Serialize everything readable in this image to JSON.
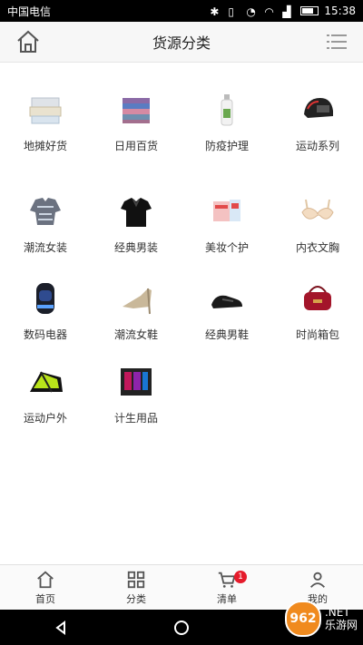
{
  "status": {
    "carrier": "中国电信",
    "time": "15:38",
    "icons": [
      "bluetooth-icon",
      "vibrate-icon",
      "alarm-icon",
      "wifi-icon",
      "signal-icon",
      "battery-icon"
    ]
  },
  "header": {
    "title": "货源分类",
    "left_icon": "home-icon",
    "right_icon": "list-menu-icon"
  },
  "categories": [
    {
      "label": "地摊好货",
      "icon": "storage-boxes-icon"
    },
    {
      "label": "日用百货",
      "icon": "towels-icon"
    },
    {
      "label": "防疫护理",
      "icon": "spray-bottle-icon"
    },
    {
      "label": "运动系列",
      "icon": "helmet-icon"
    },
    {
      "label": "潮流女装",
      "icon": "blouse-icon"
    },
    {
      "label": "经典男装",
      "icon": "polo-shirt-icon"
    },
    {
      "label": "美妆个护",
      "icon": "cosmetics-icon"
    },
    {
      "label": "内衣文胸",
      "icon": "bra-icon"
    },
    {
      "label": "数码电器",
      "icon": "mosquito-lamp-icon"
    },
    {
      "label": "潮流女鞋",
      "icon": "heel-shoe-icon"
    },
    {
      "label": "经典男鞋",
      "icon": "men-shoe-icon"
    },
    {
      "label": "时尚箱包",
      "icon": "handbag-icon"
    },
    {
      "label": "运动户外",
      "icon": "tent-icon"
    },
    {
      "label": "计生用品",
      "icon": "adult-products-icon"
    }
  ],
  "tabs": [
    {
      "label": "首页",
      "icon": "home-icon"
    },
    {
      "label": "分类",
      "icon": "grid-icon"
    },
    {
      "label": "清单",
      "icon": "cart-icon",
      "badge": "1"
    },
    {
      "label": "我的",
      "icon": "user-icon"
    }
  ],
  "watermark": {
    "badge": "962",
    "text": ".NET",
    "subtext": "乐游网"
  },
  "colors": {
    "badge": "#e51b2b",
    "watermark": "#f08a1e"
  }
}
